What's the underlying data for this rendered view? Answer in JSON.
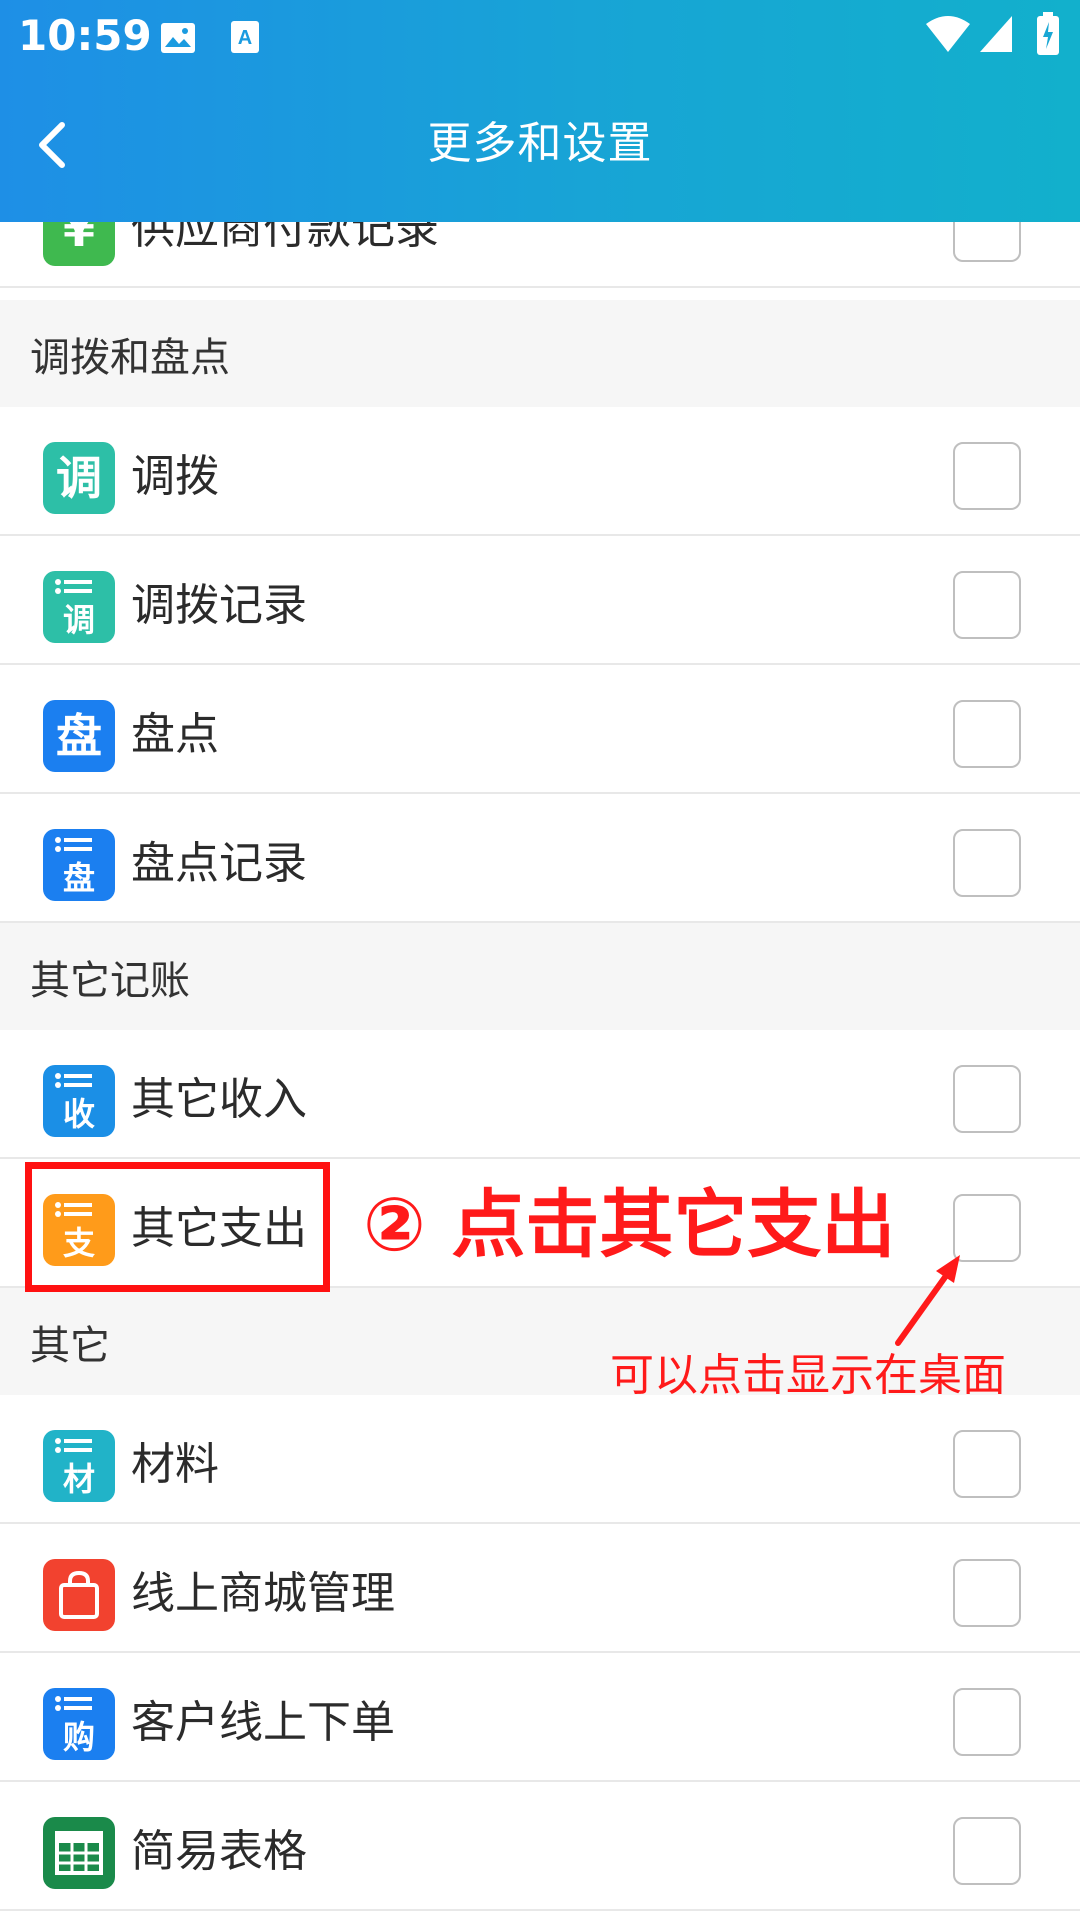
{
  "status_bar": {
    "time": "10:59"
  },
  "header": {
    "title": "更多和设置"
  },
  "sections": [
    {
      "title": "调拨和盘点"
    },
    {
      "title": "其它记账"
    },
    {
      "title": "其它"
    }
  ],
  "rows": [
    {
      "label": "供应商付款记录",
      "icon_glyph": "¥",
      "icon_name": "yen-icon",
      "color": "#3fb94f"
    },
    {
      "label": "调拨",
      "icon_glyph": "调",
      "icon_name": "transfer-icon",
      "color": "#2dbfa7"
    },
    {
      "label": "调拨记录",
      "icon_glyph": "调",
      "icon_name": "transfer-record-icon",
      "color": "#2dbfa7"
    },
    {
      "label": "盘点",
      "icon_glyph": "盘",
      "icon_name": "stocktake-icon",
      "color": "#1b7ff0"
    },
    {
      "label": "盘点记录",
      "icon_glyph": "盘",
      "icon_name": "stocktake-record-icon",
      "color": "#1b7ff0"
    },
    {
      "label": "其它收入",
      "icon_glyph": "收",
      "icon_name": "other-income-icon",
      "color": "#1b8fe6"
    },
    {
      "label": "其它支出",
      "icon_glyph": "支",
      "icon_name": "other-expense-icon",
      "color": "#ff9b1a"
    },
    {
      "label": "材料",
      "icon_glyph": "材",
      "icon_name": "material-icon",
      "color": "#21b3c8"
    },
    {
      "label": "线上商城管理",
      "icon_glyph": "",
      "icon_name": "shopping-bag-icon",
      "color": "#f2422f"
    },
    {
      "label": "客户线上下单",
      "icon_glyph": "购",
      "icon_name": "online-order-icon",
      "color": "#1b7ff0"
    },
    {
      "label": "简易表格",
      "icon_glyph": "",
      "icon_name": "table-icon",
      "color": "#1a8a4a"
    }
  ],
  "annotations": {
    "main": "② 点击其它支出",
    "sub": "可以点击显示在桌面"
  }
}
